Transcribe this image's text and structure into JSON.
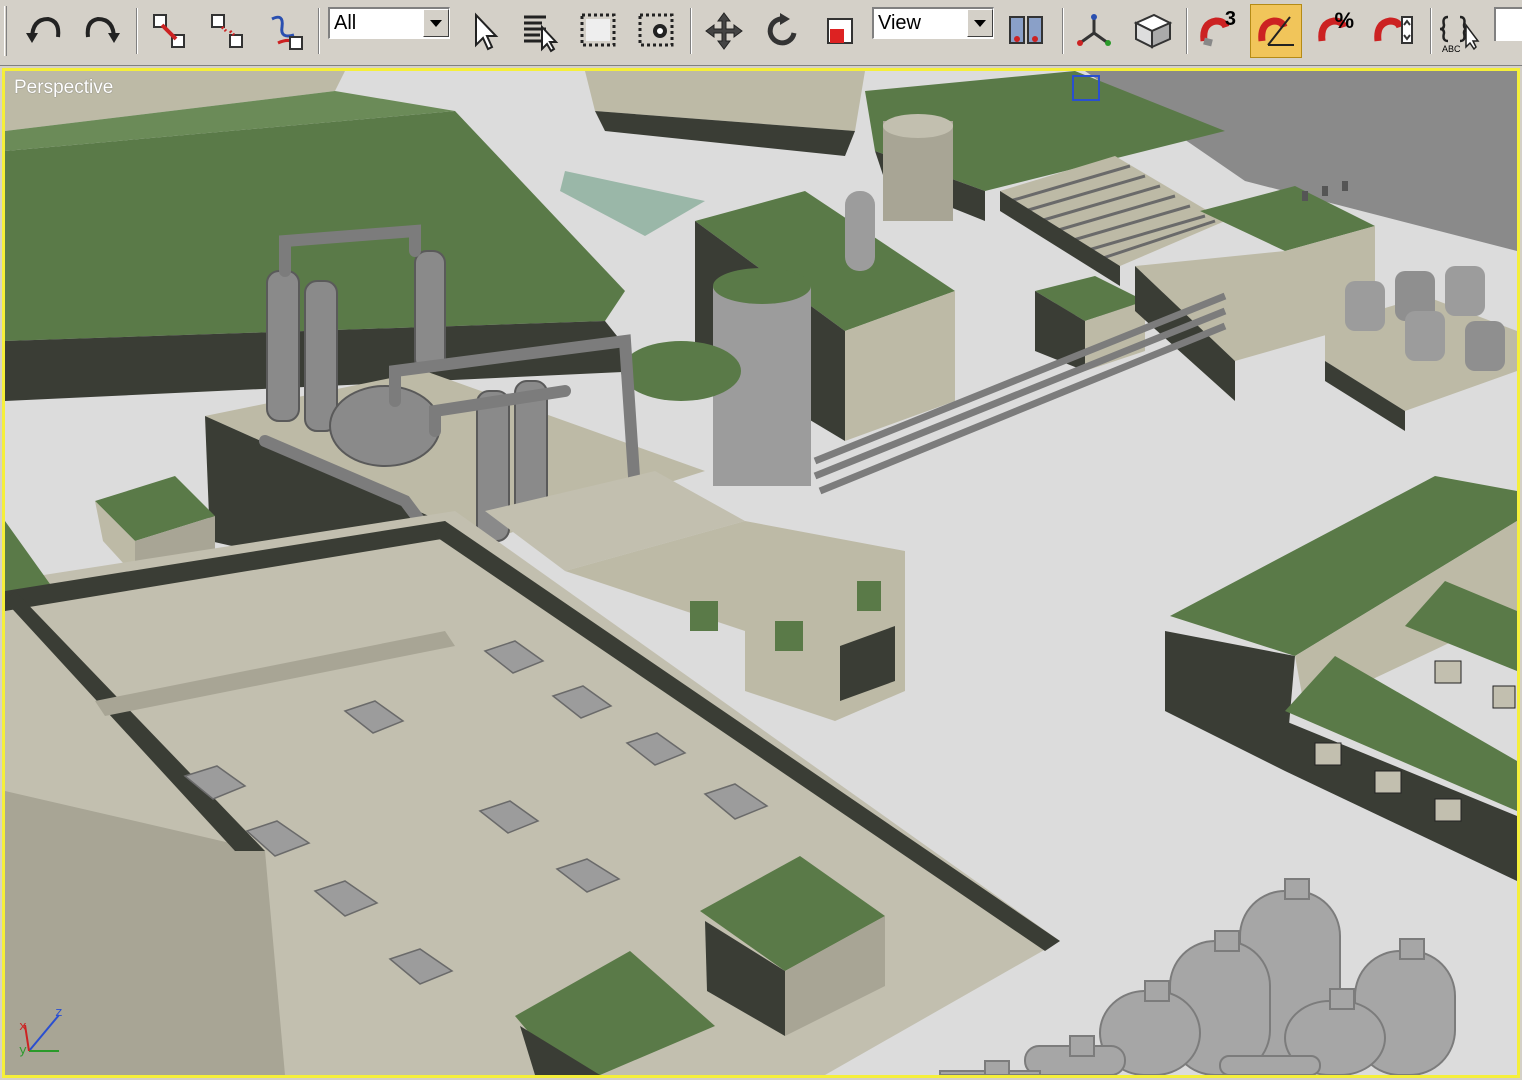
{
  "toolbar": {
    "selection_filter": {
      "value": "All"
    },
    "reference_coordinate": {
      "value": "View"
    },
    "snap_toggle": {
      "superscript": "3"
    },
    "percent_snap": {
      "symbol": "%"
    },
    "named_selection": {
      "value": "ABC"
    }
  },
  "viewport": {
    "label": "Perspective",
    "border_color": "#f5ef3a",
    "axes": {
      "x": "x",
      "y": "y",
      "z": "z"
    }
  },
  "colors": {
    "toolbar_bg": "#d4d0c8",
    "active_button": "#f1c55a",
    "roof_green": "#5a7a48",
    "wall_beige": "#bdbaa6",
    "wall_dark": "#3a3d35",
    "ground": "#dcdcdc",
    "metal": "#9c9c9c"
  }
}
